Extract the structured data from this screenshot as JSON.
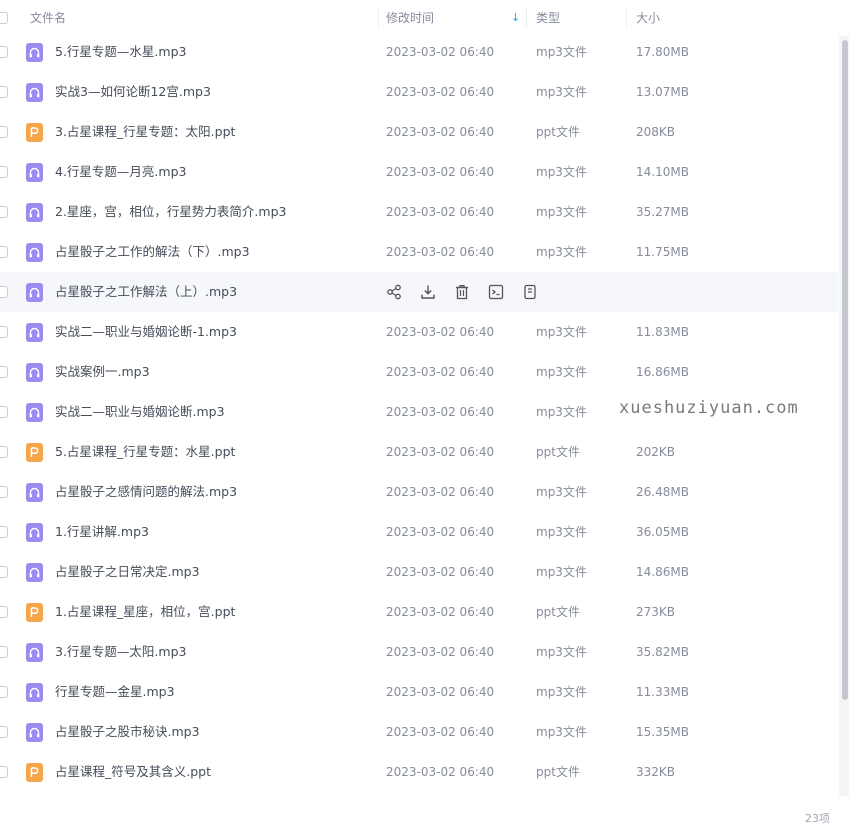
{
  "header": {
    "name_label": "文件名",
    "time_label": "修改时间",
    "type_label": "类型",
    "size_label": "大小",
    "sort_indicator": "↓"
  },
  "files": [
    {
      "name": "5.行星专题—水星.mp3",
      "time": "2023-03-02 06:40",
      "type": "mp3文件",
      "size": "17.80MB",
      "icon": "audio-file-icon"
    },
    {
      "name": "实战3—如何论断12宫.mp3",
      "time": "2023-03-02 06:40",
      "type": "mp3文件",
      "size": "13.07MB",
      "icon": "audio-file-icon"
    },
    {
      "name": "3.占星课程_行星专题：太阳.ppt",
      "time": "2023-03-02 06:40",
      "type": "ppt文件",
      "size": "208KB",
      "icon": "ppt-file-icon"
    },
    {
      "name": "4.行星专题—月亮.mp3",
      "time": "2023-03-02 06:40",
      "type": "mp3文件",
      "size": "14.10MB",
      "icon": "audio-file-icon"
    },
    {
      "name": "2.星座，宫，相位，行星势力表简介.mp3",
      "time": "2023-03-02 06:40",
      "type": "mp3文件",
      "size": "35.27MB",
      "icon": "audio-file-icon"
    },
    {
      "name": "占星骰子之工作的解法（下）.mp3",
      "time": "2023-03-02 06:40",
      "type": "mp3文件",
      "size": "11.75MB",
      "icon": "audio-file-icon"
    },
    {
      "name": "占星骰子之工作解法（上）.mp3",
      "time": "",
      "type": "",
      "size": "",
      "icon": "audio-file-icon",
      "hover": true
    },
    {
      "name": "实战二—职业与婚姻论断-1.mp3",
      "time": "2023-03-02 06:40",
      "type": "mp3文件",
      "size": "11.83MB",
      "icon": "audio-file-icon"
    },
    {
      "name": "实战案例一.mp3",
      "time": "2023-03-02 06:40",
      "type": "mp3文件",
      "size": "16.86MB",
      "icon": "audio-file-icon"
    },
    {
      "name": "实战二—职业与婚姻论断.mp3",
      "time": "2023-03-02 06:40",
      "type": "mp3文件",
      "size": "",
      "icon": "audio-file-icon"
    },
    {
      "name": "5.占星课程_行星专题：水星.ppt",
      "time": "2023-03-02 06:40",
      "type": "ppt文件",
      "size": "202KB",
      "icon": "ppt-file-icon"
    },
    {
      "name": "占星骰子之感情问题的解法.mp3",
      "time": "2023-03-02 06:40",
      "type": "mp3文件",
      "size": "26.48MB",
      "icon": "audio-file-icon"
    },
    {
      "name": "1.行星讲解.mp3",
      "time": "2023-03-02 06:40",
      "type": "mp3文件",
      "size": "36.05MB",
      "icon": "audio-file-icon"
    },
    {
      "name": "占星骰子之日常决定.mp3",
      "time": "2023-03-02 06:40",
      "type": "mp3文件",
      "size": "14.86MB",
      "icon": "audio-file-icon"
    },
    {
      "name": "1.占星课程_星座，相位，宫.ppt",
      "time": "2023-03-02 06:40",
      "type": "ppt文件",
      "size": "273KB",
      "icon": "ppt-file-icon"
    },
    {
      "name": "3.行星专题—太阳.mp3",
      "time": "2023-03-02 06:40",
      "type": "mp3文件",
      "size": "35.82MB",
      "icon": "audio-file-icon"
    },
    {
      "name": "行星专题—金星.mp3",
      "time": "2023-03-02 06:40",
      "type": "mp3文件",
      "size": "11.33MB",
      "icon": "audio-file-icon"
    },
    {
      "name": "占星骰子之股市秘诀.mp3",
      "time": "2023-03-02 06:40",
      "type": "mp3文件",
      "size": "15.35MB",
      "icon": "audio-file-icon"
    },
    {
      "name": "占星课程_符号及其含义.ppt",
      "time": "2023-03-02 06:40",
      "type": "ppt文件",
      "size": "332KB",
      "icon": "ppt-file-icon"
    }
  ],
  "hover_actions": [
    "share-icon",
    "download-icon",
    "delete-icon",
    "move-icon",
    "copy-icon"
  ],
  "watermark": "xueshuziyuan.com",
  "footer": {
    "count": "23项"
  },
  "colors": {
    "accent": "#06a7ff",
    "audio_icon": "#9a8cf1",
    "ppt_icon": "#f5a64a"
  }
}
